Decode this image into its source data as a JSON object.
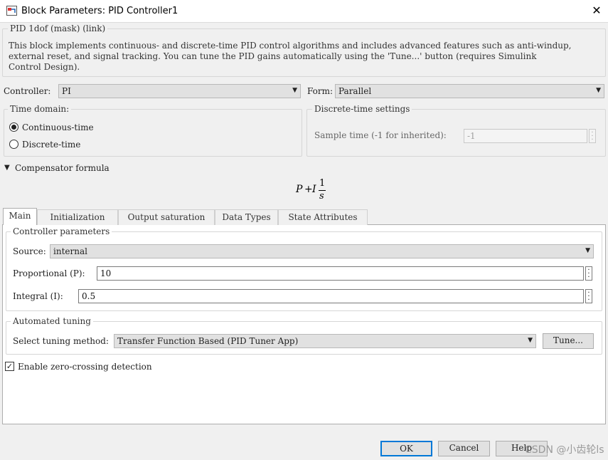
{
  "window": {
    "title": "Block Parameters: PID Controller1",
    "close_glyph": "✕"
  },
  "header": {
    "legend": "PID 1dof (mask) (link)",
    "description": "This block implements continuous- and discrete-time PID control algorithms and includes advanced features such as anti-windup,\nexternal reset, and signal tracking. You can tune the PID gains automatically using the 'Tune...' button (requires Simulink\nControl Design)."
  },
  "controller": {
    "label": "Controller:",
    "value": "PI"
  },
  "form": {
    "label": "Form:",
    "value": "Parallel"
  },
  "time_domain": {
    "legend": "Time domain:",
    "options": [
      {
        "label": "Continuous-time",
        "checked": true
      },
      {
        "label": "Discrete-time",
        "checked": false
      }
    ]
  },
  "discrete_settings": {
    "legend": "Discrete-time settings",
    "sample_label": "Sample time (-1 for inherited):",
    "sample_value": "-1"
  },
  "compensator": {
    "toggle_glyph": "▼",
    "label": "Compensator formula",
    "formula": {
      "p": "P",
      "plus": "+",
      "i": "I",
      "num": "1",
      "den": "s"
    }
  },
  "tabs": [
    {
      "label": "Main",
      "active": true
    },
    {
      "label": "Initialization",
      "active": false
    },
    {
      "label": "Output saturation",
      "active": false
    },
    {
      "label": "Data Types",
      "active": false
    },
    {
      "label": "State Attributes",
      "active": false
    }
  ],
  "controller_params": {
    "legend": "Controller parameters",
    "source_label": "Source:",
    "source_value": "internal",
    "p_label": "Proportional (P):",
    "p_value": "10",
    "i_label": "Integral (I):",
    "i_value": "0.5"
  },
  "tuning": {
    "legend": "Automated tuning",
    "method_label": "Select tuning method:",
    "method_value": "Transfer Function Based (PID Tuner App)",
    "tune_button": "Tune..."
  },
  "zero_crossing": {
    "label": "Enable zero-crossing detection",
    "checked": true,
    "check_glyph": "✓"
  },
  "footer": {
    "ok": "OK",
    "cancel": "Cancel",
    "help": "Help"
  },
  "watermark": "CSDN @小齿轮ls",
  "icons": {
    "dropdown": "dropdown-arrow-icon",
    "ellipsis": "ellipsis-icon"
  }
}
